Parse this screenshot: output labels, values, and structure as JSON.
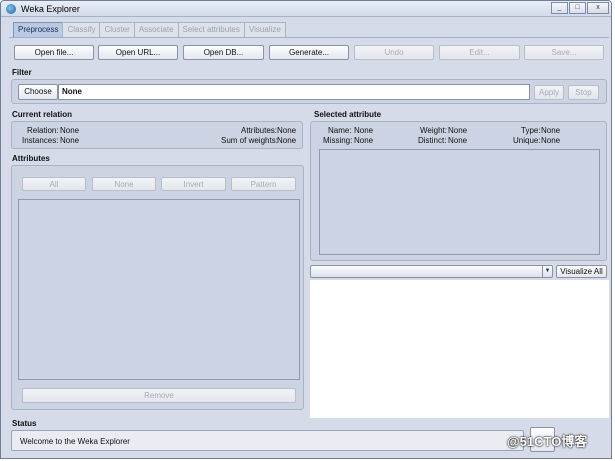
{
  "window": {
    "title": "Weka Explorer",
    "minimize_glyph": "_",
    "maximize_glyph": "□",
    "close_glyph": "x"
  },
  "tabs": [
    "Preprocess",
    "Classify",
    "Cluster",
    "Associate",
    "Select attributes",
    "Visualize"
  ],
  "toolbar": {
    "open_file": "Open file...",
    "open_url": "Open URL...",
    "open_db": "Open DB...",
    "generate": "Generate...",
    "undo": "Undo",
    "edit": "Edit...",
    "save": "Save..."
  },
  "filter": {
    "section_label": "Filter",
    "choose": "Choose",
    "value": "None",
    "apply": "Apply",
    "stop": "Stop"
  },
  "current_relation": {
    "section_label": "Current relation",
    "relation_label": "Relation:",
    "relation_value": "None",
    "instances_label": "Instances:",
    "instances_value": "None",
    "attributes_label": "Attributes:",
    "attributes_value": "None",
    "weights_label": "Sum of weights:",
    "weights_value": "None"
  },
  "attributes": {
    "section_label": "Attributes",
    "all": "All",
    "none": "None",
    "invert": "Invert",
    "pattern": "Pattern",
    "remove": "Remove"
  },
  "selected_attribute": {
    "section_label": "Selected attribute",
    "name_label": "Name:",
    "name_value": "None",
    "missing_label": "Missing:",
    "missing_value": "None",
    "weight_label": "Weight:",
    "weight_value": "None",
    "distinct_label": "Distinct:",
    "distinct_value": "None",
    "type_label": "Type:",
    "type_value": "None",
    "unique_label": "Unique:",
    "unique_value": "None",
    "combo_value": "",
    "visualize_all": "Visualize All"
  },
  "status": {
    "section_label": "Status",
    "message": "Welcome to the Weka Explorer"
  },
  "watermark": "@51CTO博客",
  "icons": {
    "app": "weka-bird-icon",
    "log": "log-button-icon",
    "x_status": "weka-status-bird-icon"
  }
}
